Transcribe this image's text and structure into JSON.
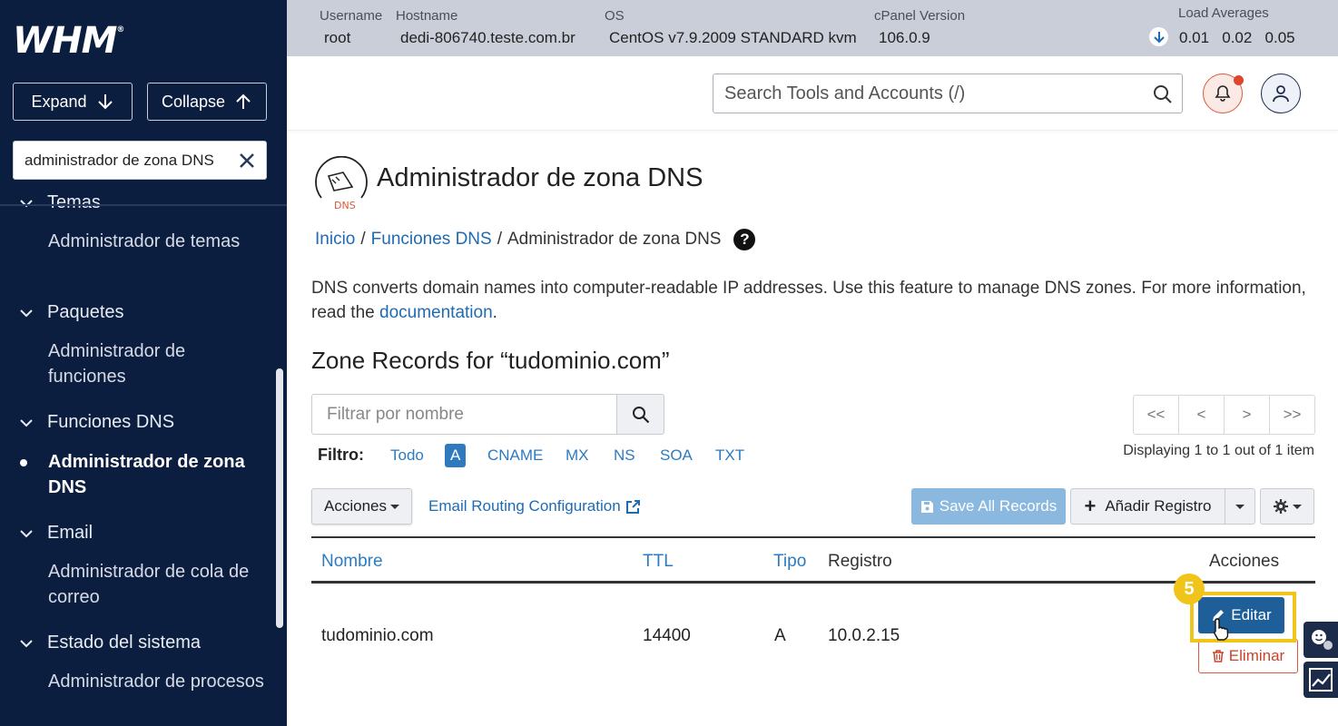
{
  "sidebar": {
    "logo": "WHM",
    "logo_mark": "®",
    "expand_label": "Expand",
    "collapse_label": "Collapse",
    "search_value": "administrador de zona DNS",
    "groups": [
      {
        "label": "Temas",
        "items": [
          "Administrador de temas"
        ]
      },
      {
        "label": "Paquetes",
        "items": [
          "Administrador de funciones"
        ]
      },
      {
        "label": "Funciones DNS",
        "items": [
          "Administrador de zona DNS"
        ]
      },
      {
        "label": "Email",
        "items": [
          "Administrador de cola de correo"
        ]
      },
      {
        "label": "Estado del sistema",
        "items": [
          "Administrador de procesos"
        ]
      }
    ]
  },
  "infobar": {
    "username_label": "Username",
    "username": "root",
    "hostname_label": "Hostname",
    "hostname": "dedi-806740.teste.com.br",
    "os_label": "OS",
    "os": "CentOS v7.9.2009 STANDARD kvm",
    "cpanel_label": "cPanel Version",
    "cpanel_version": "106.0.9",
    "load_label": "Load Averages",
    "load_values": "0.01   0.02   0.05"
  },
  "header": {
    "search_placeholder": "Search Tools and Accounts (/)"
  },
  "main": {
    "logo_text": "DNS",
    "title": "Administrador de zona DNS",
    "breadcrumb": {
      "home": "Inicio",
      "sep": "/",
      "parent": "Funciones DNS",
      "current": "Administrador de zona DNS",
      "help": "?"
    },
    "description_before": "DNS converts domain names into computer-readable IP addresses. Use this feature to manage DNS zones. For more information, read the ",
    "description_link": "documentation",
    "description_after": ".",
    "zone_title": "Zone Records for “tudominio.com”",
    "filter_placeholder": "Filtrar por nombre",
    "filtro_label": "Filtro:",
    "filter_types": [
      "Todo",
      "A",
      "CNAME",
      "MX",
      "NS",
      "SOA",
      "TXT"
    ],
    "pager": [
      "<<",
      "<",
      ">",
      ">>"
    ],
    "displaying": "Displaying 1 to 1 out of 1 item",
    "acciones_label": "Acciones",
    "email_routing_label": "Email Routing Configuration",
    "save_all_label": "Save All Records",
    "add_record_label": "Añadir Registro",
    "table": {
      "headers": {
        "name": "Nombre",
        "ttl": "TTL",
        "type": "Tipo",
        "record": "Registro",
        "actions": "Acciones"
      },
      "rows": [
        {
          "name": "tudominio.com",
          "ttl": "14400",
          "type": "A",
          "record": "10.0.2.15"
        }
      ]
    },
    "edit_label": "Editar",
    "delete_label": "Eliminar",
    "step_number": "5"
  },
  "colors": {
    "sidebar_bg": "#0b1e3f",
    "infobar_bg": "#c9ced8",
    "link": "#1e6bb3",
    "primary_button": "#1f5f99",
    "danger": "#d8593d",
    "highlight": "#f0c419"
  }
}
